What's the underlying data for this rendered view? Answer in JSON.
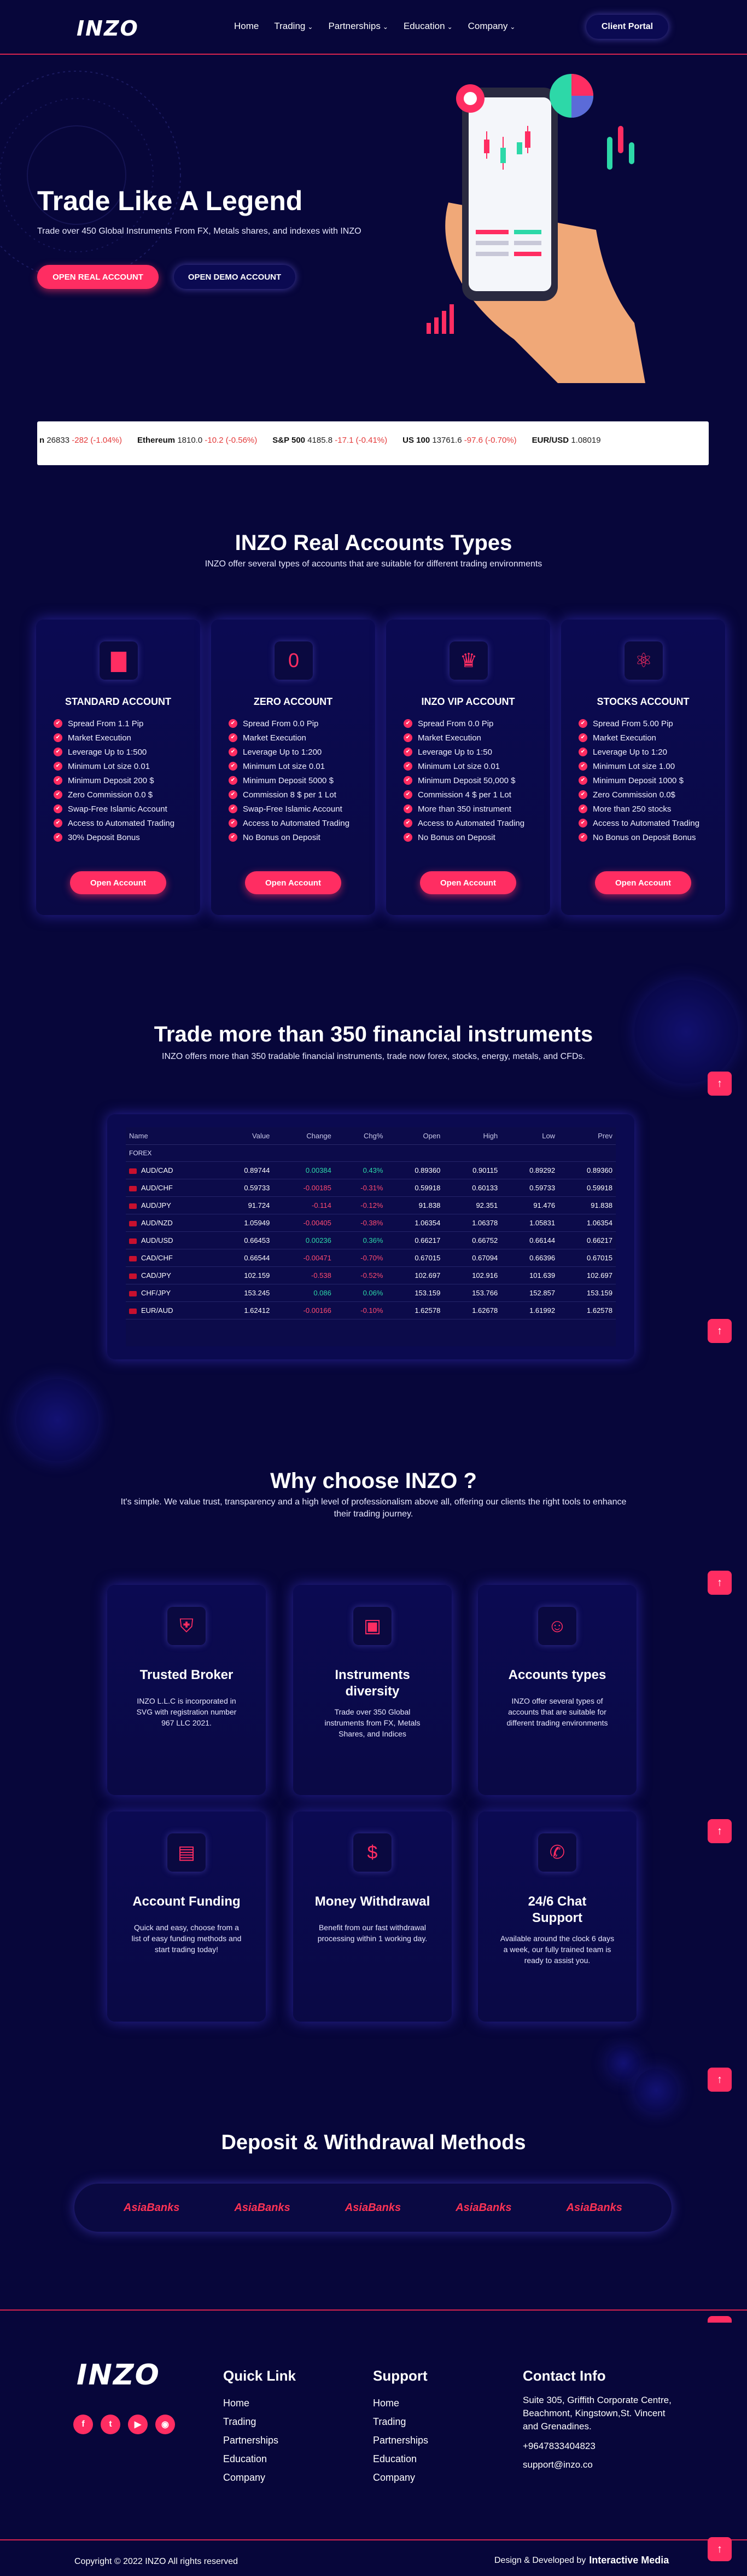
{
  "header": {
    "logo": "INZO",
    "nav": [
      "Home",
      "Trading",
      "Partnerships",
      "Education",
      "Company"
    ],
    "portal": "Client Portal"
  },
  "hero": {
    "title": "Trade Like A Legend",
    "subtitle": "Trade over 450 Global Instruments From FX, Metals shares, and indexes with INZO",
    "btn_real": "OPEN REAL ACCOUNT",
    "btn_demo": "OPEN DEMO ACCOUNT"
  },
  "ticker": [
    {
      "name": "n",
      "price": "26833",
      "chg": "-282 (-1.04%)"
    },
    {
      "name": "Ethereum",
      "price": "1810.0",
      "chg": "-10.2 (-0.56%)"
    },
    {
      "name": "S&P 500",
      "price": "4185.8",
      "chg": "-17.1 (-0.41%)"
    },
    {
      "name": "US 100",
      "price": "13761.6",
      "chg": "-97.6 (-0.70%)"
    },
    {
      "name": "EUR/USD",
      "price": "1.08019",
      "chg": ""
    }
  ],
  "accounts": {
    "title": "INZO Real Accounts Types",
    "subtitle": "INZO offer several types of accounts that are suitable for different trading environments",
    "button": "Open Account",
    "cards": [
      {
        "name": "STANDARD ACCOUNT",
        "icon": "bar-chart-icon",
        "features": [
          "Spread From 1.1 Pip",
          "Market Execution",
          "Leverage Up to 1:500",
          "Minimum Lot size 0.01",
          "Minimum Deposit 200 $",
          "Zero Commission 0.0 $",
          "Swap-Free Islamic Account",
          "Access to Automated Trading",
          "30% Deposit Bonus"
        ]
      },
      {
        "name": "ZERO ACCOUNT",
        "icon": "zero-icon",
        "features": [
          "Spread From 0.0 Pip",
          "Market Execution",
          "Leverage Up to 1:200",
          "Minimum Lot size 0.01",
          "Minimum Deposit 5000 $",
          "Commission 8 $ per 1 Lot",
          "Swap-Free Islamic Account",
          "Access to Automated Trading",
          "No Bonus on Deposit"
        ]
      },
      {
        "name": "INZO VIP ACCOUNT",
        "icon": "crown-icon",
        "features": [
          "Spread From 0.0 Pip",
          "Market Execution",
          "Leverage Up to 1:50",
          "Minimum Lot size 0.01",
          "Minimum Deposit 50,000 $",
          "Commission 4 $ per 1 Lot",
          "More than 350 instrument",
          "Access to Automated Trading",
          "No Bonus on Deposit"
        ]
      },
      {
        "name": "STOCKS ACCOUNT",
        "icon": "atom-icon",
        "features": [
          "Spread From 5.00 Pip",
          "Market Execution",
          "Leverage Up to 1:20",
          "Minimum Lot size 1.00",
          "Minimum Deposit 1000 $",
          "Zero Commission 0.0$",
          "More than 250 stocks",
          "Access to Automated Trading",
          "No Bonus on Deposit Bonus"
        ]
      }
    ]
  },
  "instruments": {
    "title": "Trade more than 350 financial instruments",
    "subtitle": "INZO offers more than 350 tradable financial instruments, trade now forex, stocks, energy, metals, and CFDs.",
    "headers": [
      "Name",
      "Value",
      "Change",
      "Chg%",
      "Open",
      "High",
      "Low",
      "Prev"
    ],
    "group": "FOREX",
    "rows": [
      [
        "AUD/CAD",
        "0.89744",
        "0.00384",
        "0.43%",
        "0.89360",
        "0.90115",
        "0.89292",
        "0.89360"
      ],
      [
        "AUD/CHF",
        "0.59733",
        "-0.00185",
        "-0.31%",
        "0.59918",
        "0.60133",
        "0.59733",
        "0.59918"
      ],
      [
        "AUD/JPY",
        "91.724",
        "-0.114",
        "-0.12%",
        "91.838",
        "92.351",
        "91.476",
        "91.838"
      ],
      [
        "AUD/NZD",
        "1.05949",
        "-0.00405",
        "-0.38%",
        "1.06354",
        "1.06378",
        "1.05831",
        "1.06354"
      ],
      [
        "AUD/USD",
        "0.66453",
        "0.00236",
        "0.36%",
        "0.66217",
        "0.66752",
        "0.66144",
        "0.66217"
      ],
      [
        "CAD/CHF",
        "0.66544",
        "-0.00471",
        "-0.70%",
        "0.67015",
        "0.67094",
        "0.66396",
        "0.67015"
      ],
      [
        "CAD/JPY",
        "102.159",
        "-0.538",
        "-0.52%",
        "102.697",
        "102.916",
        "101.639",
        "102.697"
      ],
      [
        "CHF/JPY",
        "153.245",
        "0.086",
        "0.06%",
        "153.159",
        "153.766",
        "152.857",
        "153.159"
      ],
      [
        "EUR/AUD",
        "1.62412",
        "-0.00166",
        "-0.10%",
        "1.62578",
        "1.62678",
        "1.61992",
        "1.62578"
      ]
    ]
  },
  "why": {
    "title": "Why choose INZO ?",
    "subtitle": "It's simple. We value trust, transparency and a high level of professionalism above all, offering our clients the right tools to enhance their trading journey.",
    "cards": [
      {
        "title": "Trusted Broker",
        "icon": "shield-icon",
        "desc": "INZO L.L.C is incorporated in SVG with registration number 967 LLC 2021."
      },
      {
        "title": "Instruments diversity",
        "icon": "monitor-icon",
        "desc": "Trade over 350 Global instruments from FX, Metals Shares, and Indices"
      },
      {
        "title": "Accounts types",
        "icon": "user-icon",
        "desc": "INZO offer several types of accounts that are suitable for different trading environments"
      },
      {
        "title": "Account Funding",
        "icon": "cash-icon",
        "desc": "Quick and easy, choose from a list of easy funding methods and start trading today!"
      },
      {
        "title": "Money Withdrawal",
        "icon": "money-hand-icon",
        "desc": "Benefit from our fast withdrawal processing within 1 working day."
      },
      {
        "title": "24/6 Chat Support",
        "icon": "chat-support-icon",
        "desc": "Available around the clock 6 days a week, our fully trained team is ready to assist you."
      }
    ]
  },
  "payments": {
    "title": "Deposit & Withdrawal Methods",
    "logos": [
      "AsiaBanks",
      "AsiaBanks",
      "AsiaBanks",
      "AsiaBanks",
      "AsiaBanks"
    ]
  },
  "footer": {
    "quick_title": "Quick Link",
    "quick": [
      "Home",
      "Trading",
      "Partnerships",
      "Education",
      "Company"
    ],
    "support_title": "Support",
    "support": [
      "Home",
      "Trading",
      "Partnerships",
      "Education",
      "Company"
    ],
    "contact_title": "Contact Info",
    "address": "Suite 305, Griffith Corporate Centre, Beachmont, Kingstown,St. Vincent and Grenadines.",
    "phone": "+9647833404823",
    "email": "support@inzo.co",
    "copyright": "Copyright © 2022 INZO All rights reserved",
    "designed_by": "Design & Developed by",
    "developer": "Interactive Media"
  },
  "colors": {
    "accent": "#ff2d62",
    "background": "#07063a",
    "card": "#0b0a52"
  }
}
